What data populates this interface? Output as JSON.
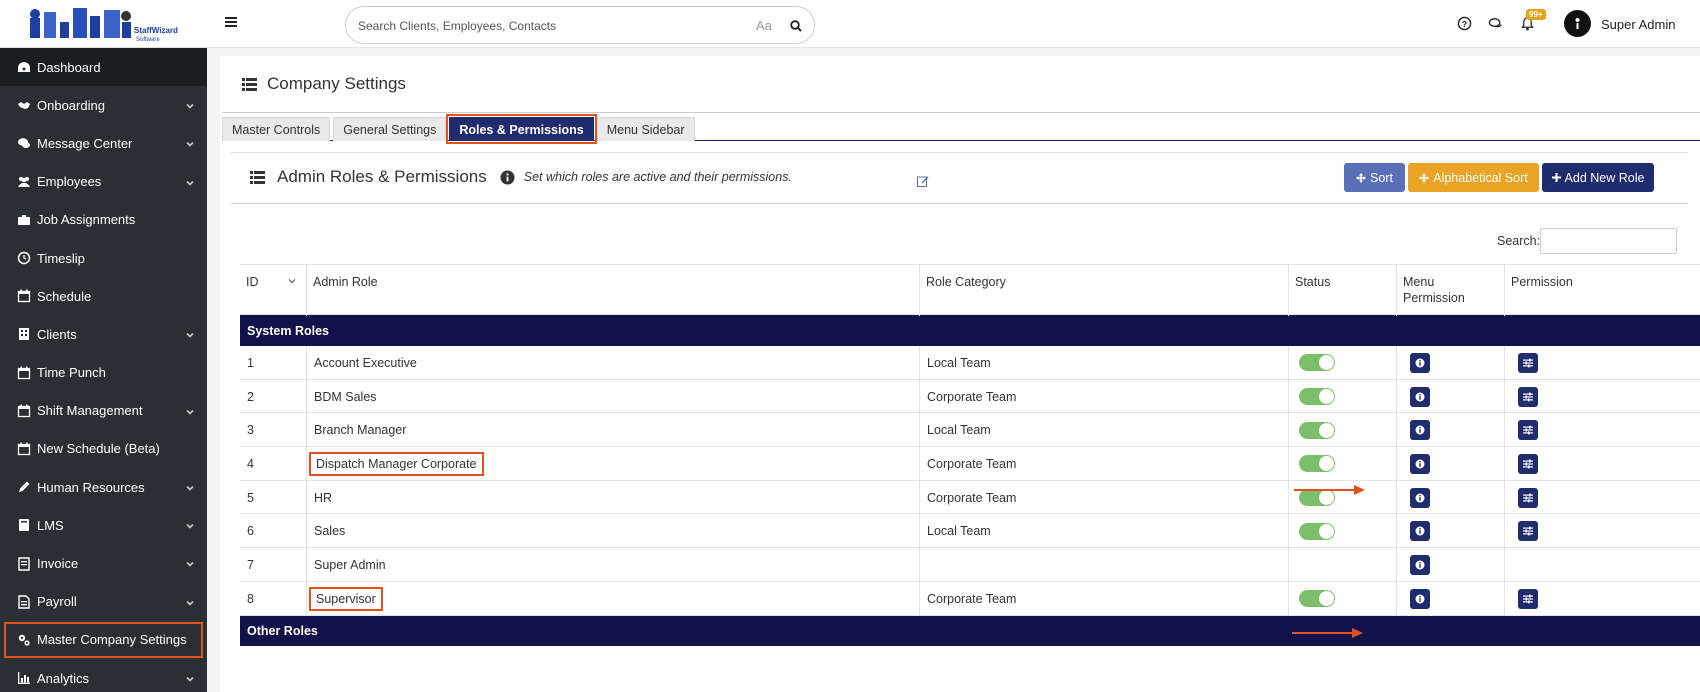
{
  "logo": {
    "text": "StaffWizard Software"
  },
  "sidebar": {
    "items": [
      {
        "label": "Dashboard",
        "icon": "dashboard-icon",
        "chevron": false
      },
      {
        "label": "Onboarding",
        "icon": "handshake-icon",
        "chevron": true
      },
      {
        "label": "Message Center",
        "icon": "chat-icon",
        "chevron": true
      },
      {
        "label": "Employees",
        "icon": "users-icon",
        "chevron": true
      },
      {
        "label": "Job Assignments",
        "icon": "briefcase-icon",
        "chevron": false
      },
      {
        "label": "Timeslip",
        "icon": "clock-icon",
        "chevron": false
      },
      {
        "label": "Schedule",
        "icon": "calendar-icon",
        "chevron": false
      },
      {
        "label": "Clients",
        "icon": "building-icon",
        "chevron": true
      },
      {
        "label": "Time Punch",
        "icon": "calendar-icon",
        "chevron": false
      },
      {
        "label": "Shift Management",
        "icon": "calendar-icon",
        "chevron": true
      },
      {
        "label": "New Schedule (Beta)",
        "icon": "calendar-icon",
        "chevron": false
      },
      {
        "label": "Human Resources",
        "icon": "pencil-icon",
        "chevron": true
      },
      {
        "label": "LMS",
        "icon": "book-icon",
        "chevron": true
      },
      {
        "label": "Invoice",
        "icon": "invoice-icon",
        "chevron": true
      },
      {
        "label": "Payroll",
        "icon": "payroll-icon",
        "chevron": true
      },
      {
        "label": "Master Company Settings",
        "icon": "cogs-icon",
        "chevron": false
      },
      {
        "label": "Analytics",
        "icon": "bar-chart-icon",
        "chevron": true
      }
    ]
  },
  "topbar": {
    "search_placeholder": "Search Clients, Employees, Contacts",
    "case_toggle": "Aa",
    "notification_badge": "99+",
    "user_name": "Super Admin"
  },
  "page": {
    "title": "Company Settings"
  },
  "tabs": [
    "Master Controls",
    "General Settings",
    "Roles & Permissions",
    "Menu Sidebar"
  ],
  "section": {
    "title": "Admin Roles & Permissions",
    "description": "Set which roles are active and their permissions.",
    "buttons": {
      "sort": "Sort",
      "alpha_sort": "Alphabetical Sort",
      "add_role": "Add New Role"
    },
    "search_label": "Search:"
  },
  "table": {
    "headers": {
      "id": "ID",
      "role": "Admin Role",
      "category": "Role Category",
      "status": "Status",
      "menu_perm": "Menu Permission",
      "perm": "Permission"
    },
    "groups": {
      "system": "System Roles",
      "other": "Other Roles"
    },
    "rows": [
      {
        "id": "1",
        "role": "Account Executive",
        "category": "Local Team",
        "status": true,
        "perm": true
      },
      {
        "id": "2",
        "role": "BDM Sales",
        "category": "Corporate Team",
        "status": true,
        "perm": true
      },
      {
        "id": "3",
        "role": "Branch Manager",
        "category": "Local Team",
        "status": true,
        "perm": true
      },
      {
        "id": "4",
        "role": "Dispatch Manager Corporate",
        "category": "Corporate Team",
        "status": true,
        "perm": true
      },
      {
        "id": "5",
        "role": "HR",
        "category": "Corporate Team",
        "status": true,
        "perm": true
      },
      {
        "id": "6",
        "role": "Sales",
        "category": "Local Team",
        "status": true,
        "perm": true
      },
      {
        "id": "7",
        "role": "Super Admin",
        "category": "",
        "status": false,
        "perm": false
      },
      {
        "id": "8",
        "role": "Supervisor",
        "category": "Corporate Team",
        "status": true,
        "perm": true
      }
    ]
  },
  "colors": {
    "accent": "#1f2d6e",
    "highlight": "#e1521d",
    "toggle_on": "#7bbf6a",
    "sidebar_bg": "#2b2f33"
  }
}
